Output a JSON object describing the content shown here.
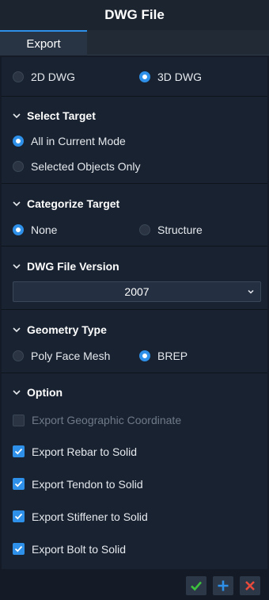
{
  "window": {
    "title": "DWG File"
  },
  "tabs": [
    {
      "label": "Export",
      "active": true
    }
  ],
  "output_mode": {
    "options": [
      "2D DWG",
      "3D DWG"
    ],
    "selected": "3D DWG"
  },
  "select_target": {
    "title": "Select Target",
    "options": [
      "All in Current Mode",
      "Selected Objects Only"
    ],
    "selected": "All in Current Mode"
  },
  "categorize_target": {
    "title": "Categorize Target",
    "options": [
      "None",
      "Structure"
    ],
    "selected": "None"
  },
  "dwg_version": {
    "title": "DWG File Version",
    "value": "2007"
  },
  "geometry_type": {
    "title": "Geometry Type",
    "options": [
      "Poly Face Mesh",
      "BREP"
    ],
    "selected": "BREP"
  },
  "option": {
    "title": "Option",
    "items": [
      {
        "label": "Export Geographic Coordinate",
        "checked": false,
        "enabled": false
      },
      {
        "label": "Export Rebar to Solid",
        "checked": true,
        "enabled": true
      },
      {
        "label": "Export Tendon to Solid",
        "checked": true,
        "enabled": true
      },
      {
        "label": "Export Stiffener to Solid",
        "checked": true,
        "enabled": true
      },
      {
        "label": "Export Bolt to Solid",
        "checked": true,
        "enabled": true
      }
    ]
  },
  "footer": {
    "buttons": [
      "check-icon",
      "plus-icon",
      "close-icon"
    ]
  },
  "colors": {
    "accent": "#2e90e8",
    "ok": "#3cc23c",
    "cancel": "#e84b3c"
  }
}
